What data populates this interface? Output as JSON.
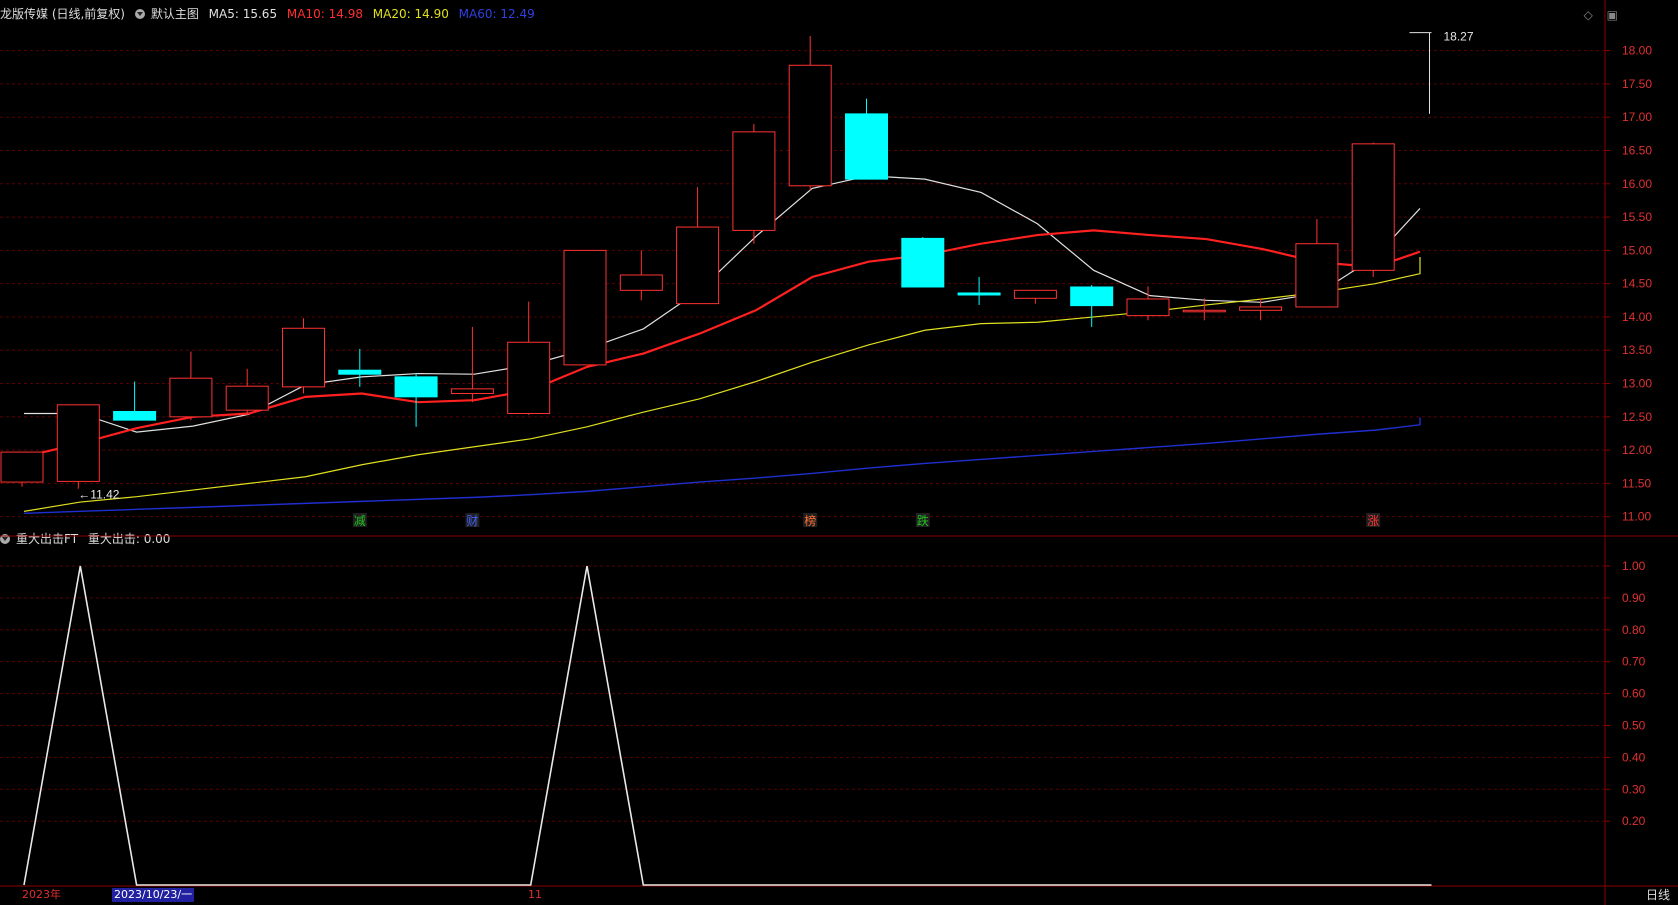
{
  "main_header": {
    "title": "龙版传媒 (日线,前复权)",
    "indicator": "默认主图",
    "ma5": "MA5: 15.65",
    "ma10": "MA10: 14.98",
    "ma20": "MA20: 14.90",
    "ma60": "MA60: 12.49"
  },
  "sub_header": {
    "indicator": "重大出击FT",
    "value": "重大出击: 0.00"
  },
  "colors": {
    "background": "#000000",
    "grid": "#5a0000",
    "axis_label": "#e03030",
    "up": "#ff3232",
    "down": "#00ffff",
    "ma5": "#e0e0e0",
    "ma10": "#ff2020",
    "ma20": "#e0e020",
    "ma60": "#1f2fd0",
    "indicator": "#e8e8e8"
  },
  "icons": [
    "collapse-icon",
    "diamond-icon",
    "window-icon"
  ],
  "period_label": "日线",
  "bottom_axis": {
    "year": "2023年",
    "cursor_date": "2023/10/23/一",
    "month": "11"
  },
  "chart_data": [
    {
      "type": "candlestick",
      "title": "龙版传媒 (日线,前复权)",
      "ylim": [
        10.8,
        18.4
      ],
      "yticks": [
        "18.00",
        "17.50",
        "17.00",
        "16.50",
        "16.00",
        "15.50",
        "15.00",
        "14.50",
        "14.00",
        "13.50",
        "13.00",
        "12.50",
        "12.00",
        "11.50",
        "11.00"
      ],
      "grid": true,
      "candles": [
        {
          "o": 11.52,
          "h": 11.97,
          "l": 11.45,
          "c": 11.97
        },
        {
          "o": 11.53,
          "h": 12.68,
          "l": 11.42,
          "c": 12.68
        },
        {
          "o": 12.58,
          "h": 13.03,
          "l": 12.45,
          "c": 12.45
        },
        {
          "o": 12.5,
          "h": 13.48,
          "l": 12.45,
          "c": 13.08
        },
        {
          "o": 12.6,
          "h": 13.22,
          "l": 12.55,
          "c": 12.96
        },
        {
          "o": 12.95,
          "h": 13.98,
          "l": 12.85,
          "c": 13.83
        },
        {
          "o": 13.2,
          "h": 13.52,
          "l": 12.95,
          "c": 13.14
        },
        {
          "o": 13.1,
          "h": 13.15,
          "l": 12.35,
          "c": 12.8
        },
        {
          "o": 12.85,
          "h": 13.85,
          "l": 12.72,
          "c": 12.92
        },
        {
          "o": 12.55,
          "h": 14.23,
          "l": 12.53,
          "c": 13.62
        },
        {
          "o": 13.28,
          "h": 15.0,
          "l": 13.28,
          "c": 15.0
        },
        {
          "o": 14.4,
          "h": 15.0,
          "l": 14.25,
          "c": 14.63
        },
        {
          "o": 14.2,
          "h": 15.95,
          "l": 14.2,
          "c": 15.35
        },
        {
          "o": 15.3,
          "h": 16.9,
          "l": 15.1,
          "c": 16.78
        },
        {
          "o": 15.97,
          "h": 18.22,
          "l": 15.9,
          "c": 17.78
        },
        {
          "o": 17.05,
          "h": 17.28,
          "l": 16.07,
          "c": 16.07
        },
        {
          "o": 15.18,
          "h": 15.2,
          "l": 14.45,
          "c": 14.45
        },
        {
          "o": 14.36,
          "h": 14.6,
          "l": 14.18,
          "c": 14.33
        },
        {
          "o": 14.28,
          "h": 14.4,
          "l": 14.2,
          "c": 14.4
        },
        {
          "o": 14.45,
          "h": 14.48,
          "l": 13.85,
          "c": 14.17
        },
        {
          "o": 14.02,
          "h": 14.46,
          "l": 13.95,
          "c": 14.27
        },
        {
          "o": 14.08,
          "h": 14.28,
          "l": 13.95,
          "c": 14.1
        },
        {
          "o": 14.1,
          "h": 14.28,
          "l": 13.95,
          "c": 14.15
        },
        {
          "o": 14.15,
          "h": 15.47,
          "l": 14.15,
          "c": 15.1
        },
        {
          "o": 14.7,
          "h": 16.62,
          "l": 14.6,
          "c": 16.6
        },
        {
          "o": 17.05,
          "h": 18.27,
          "l": 17.05,
          "c": 18.27
        }
      ],
      "series": [
        {
          "name": "MA5",
          "values": [
            12.55,
            12.55,
            12.27,
            12.36,
            12.54,
            12.98,
            13.1,
            13.15,
            13.14,
            13.28,
            13.52,
            13.82,
            14.4,
            15.21,
            15.93,
            16.12,
            16.07,
            15.87,
            15.4,
            14.7,
            14.32,
            14.25,
            14.22,
            14.36,
            14.9,
            15.63
          ]
        },
        {
          "name": "MA10",
          "values": [
            11.9,
            12.1,
            12.33,
            12.5,
            12.55,
            12.8,
            12.85,
            12.72,
            12.75,
            12.9,
            13.25,
            13.45,
            13.75,
            14.1,
            14.6,
            14.83,
            14.93,
            15.1,
            15.23,
            15.3,
            15.23,
            15.17,
            15.02,
            14.82,
            14.75,
            14.98
          ]
        },
        {
          "name": "MA20",
          "values": [
            11.08,
            11.22,
            11.3,
            11.4,
            11.5,
            11.6,
            11.78,
            11.93,
            12.05,
            12.17,
            12.35,
            12.57,
            12.77,
            13.03,
            13.32,
            13.58,
            13.8,
            13.9,
            13.92,
            14.0,
            14.08,
            14.18,
            14.27,
            14.37,
            14.5,
            14.65,
            14.9
          ]
        },
        {
          "name": "MA60",
          "values": [
            11.05,
            11.08,
            11.11,
            11.14,
            11.17,
            11.2,
            11.23,
            11.26,
            11.29,
            11.33,
            11.38,
            11.45,
            11.52,
            11.58,
            11.65,
            11.73,
            11.8,
            11.86,
            11.92,
            11.98,
            12.04,
            12.1,
            12.17,
            12.24,
            12.3,
            12.38,
            12.49
          ]
        }
      ],
      "annotations": [
        {
          "index": 1,
          "text": "←11.42"
        },
        {
          "index": 25,
          "text": "18.27"
        }
      ],
      "markers": [
        {
          "index": 6,
          "text": "减",
          "color": "#20c020"
        },
        {
          "index": 8,
          "text": "财",
          "color": "#4060ff"
        },
        {
          "index": 14,
          "text": "榜",
          "color": "#ff7030"
        },
        {
          "index": 16,
          "text": "跌",
          "color": "#20c020"
        },
        {
          "index": 24,
          "text": "涨",
          "color": "#ff3030"
        }
      ]
    },
    {
      "type": "line",
      "title": "重大出击FT",
      "ylim": [
        0,
        1.05
      ],
      "yticks": [
        "1.00",
        "0.90",
        "0.80",
        "0.70",
        "0.60",
        "0.50",
        "0.40",
        "0.30",
        "0.20"
      ],
      "grid": true,
      "series": [
        {
          "name": "重大出击",
          "values": [
            0,
            1,
            0,
            0,
            0,
            0,
            0,
            0,
            0,
            0,
            1,
            0,
            0,
            0,
            0,
            0,
            0,
            0,
            0,
            0,
            0,
            0,
            0,
            0,
            0,
            0
          ]
        }
      ]
    }
  ]
}
